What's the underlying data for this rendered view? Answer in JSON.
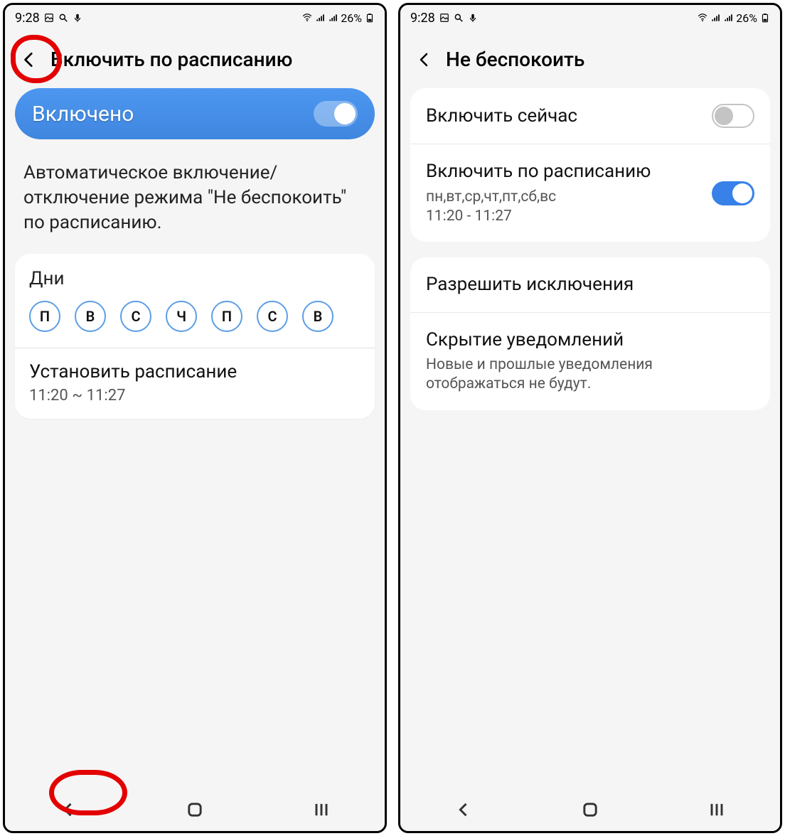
{
  "statusbar": {
    "time": "9:28",
    "battery_pct": "26%"
  },
  "left": {
    "header_title": "Включить по расписанию",
    "enabled_label": "Включено",
    "description": "Автоматическое включение/отключение режима \"Не беспокоить\" по расписанию.",
    "days_label": "Дни",
    "days": [
      "П",
      "В",
      "С",
      "Ч",
      "П",
      "С",
      "В"
    ],
    "schedule_title": "Установить расписание",
    "schedule_value": "11:20 ~ 11:27"
  },
  "right": {
    "header_title": "Не беспокоить",
    "rows": {
      "now": {
        "title": "Включить сейчас"
      },
      "schedule": {
        "title": "Включить по расписанию",
        "sub_days": "пн,вт,ср,чт,пт,сб,вс",
        "sub_time": "11:20 - 11:27"
      },
      "exceptions": {
        "title": "Разрешить исключения"
      },
      "hide": {
        "title": "Скрытие уведомлений",
        "sub": "Новые и прошлые уведомления отображаться не будут."
      }
    }
  }
}
